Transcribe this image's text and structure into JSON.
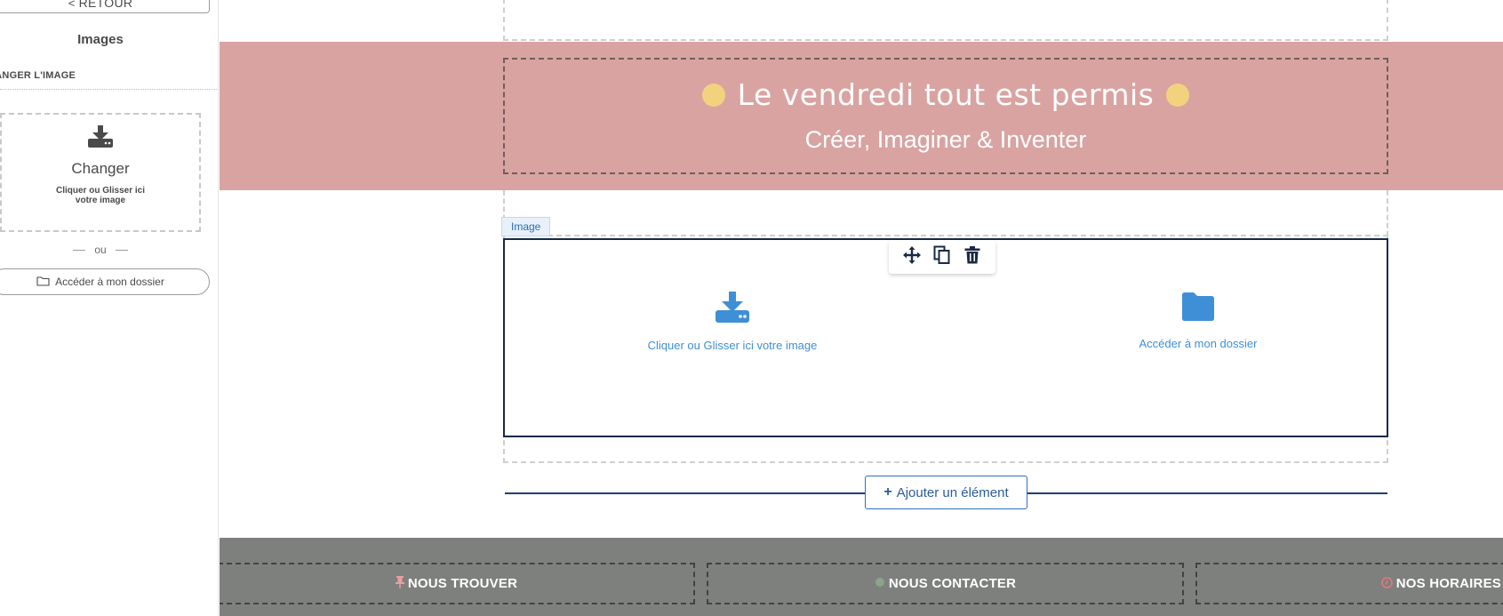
{
  "sidebar": {
    "back_label": "RETOUR",
    "title": "Images",
    "section_label": "CHANGER L'IMAGE",
    "dropzone": {
      "title": "Changer",
      "subtitle": "Cliquer ou Glisser ici votre image"
    },
    "or_label": "ou",
    "folder_button_label": "Accéder à mon dossier"
  },
  "canvas": {
    "banner": {
      "title": "Le vendredi tout est permis",
      "subtitle": "Créer, Imaginer & Inventer",
      "dot_color": "#f3d27e",
      "background_color": "#d9a3a1"
    },
    "image_block": {
      "tag_label": "Image",
      "toolbar": [
        "move-icon",
        "duplicate-icon",
        "delete-icon"
      ],
      "upload_label": "Cliquer ou Glisser ici votre image",
      "folder_label": "Accéder à mon dossier",
      "accent_color": "#3f8fd6"
    },
    "add_element_label": "Ajouter un élément",
    "footer": {
      "items": [
        {
          "label": "NOUS TROUVER",
          "icon": "pin-icon",
          "icon_color": "#e8a0a0"
        },
        {
          "label": "NOUS CONTACTER",
          "icon": "phone-icon",
          "icon_color": "#8aa58a"
        },
        {
          "label": "NOS HORAIRES",
          "icon": "clock-icon",
          "icon_color": "#e07a7a"
        }
      ],
      "background_color": "#7e807e"
    }
  }
}
